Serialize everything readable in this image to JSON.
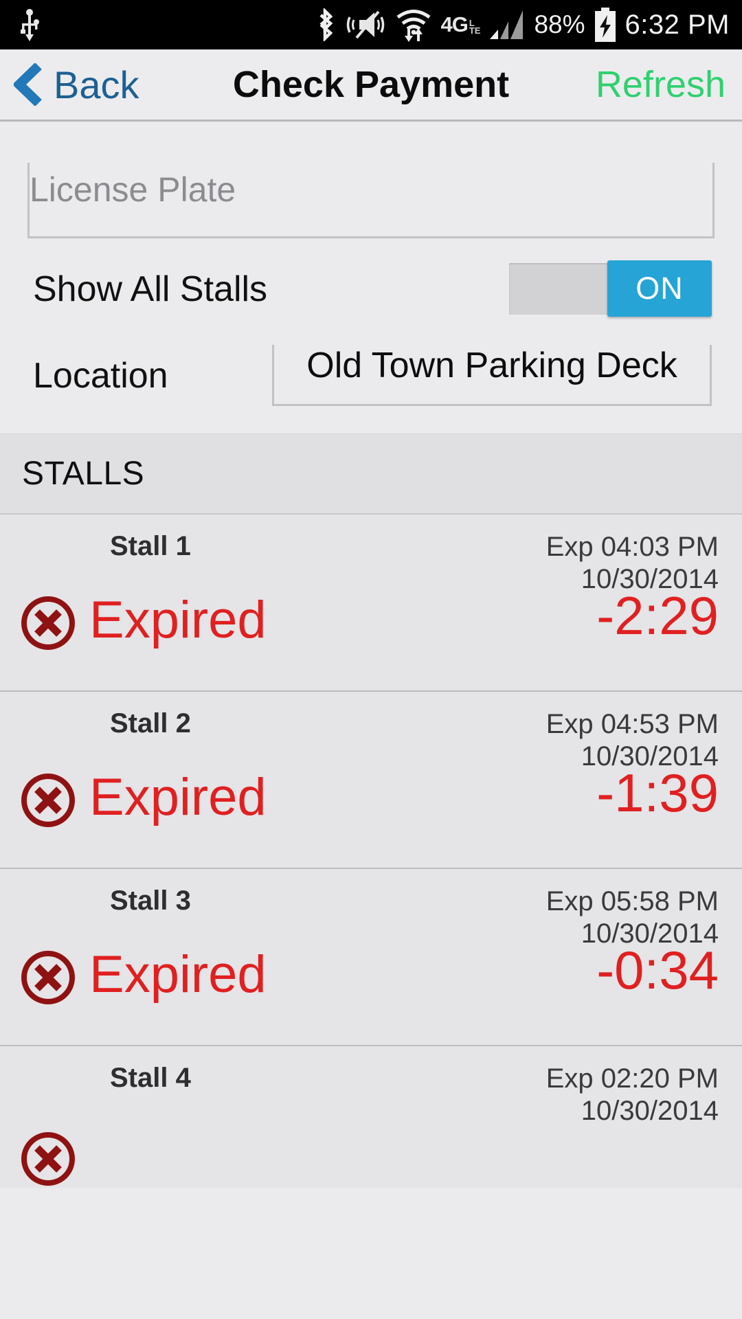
{
  "status_bar": {
    "icons": [
      "usb-icon",
      "bluetooth-icon",
      "vibrate-mute-icon",
      "wifi-icon"
    ],
    "network": "4G",
    "network_sub_top": "L",
    "network_sub_bottom": "TE",
    "battery_percent": "88%",
    "time": "6:32 PM"
  },
  "action_bar": {
    "back_label": "Back",
    "title": "Check Payment",
    "refresh_label": "Refresh"
  },
  "form": {
    "license_plate_placeholder": "License Plate",
    "license_plate_value": "",
    "show_all_stalls_label": "Show All Stalls",
    "show_all_stalls_state": "ON",
    "location_label": "Location",
    "location_value": "Old Town Parking Deck"
  },
  "section": {
    "stalls_header": "STALLS"
  },
  "stalls": [
    {
      "name": "Stall 1",
      "exp_time": "Exp 04:03 PM",
      "exp_date": "10/30/2014",
      "status": "Expired",
      "remaining": "-2:29",
      "icon": "circle-x-icon"
    },
    {
      "name": "Stall 2",
      "exp_time": "Exp 04:53 PM",
      "exp_date": "10/30/2014",
      "status": "Expired",
      "remaining": "-1:39",
      "icon": "circle-x-icon"
    },
    {
      "name": "Stall 3",
      "exp_time": "Exp 05:58 PM",
      "exp_date": "10/30/2014",
      "status": "Expired",
      "remaining": "-0:34",
      "icon": "circle-x-icon"
    },
    {
      "name": "Stall 4",
      "exp_time": "Exp 02:20 PM",
      "exp_date": "10/30/2014",
      "status": "",
      "remaining": "",
      "icon": "circle-x-icon"
    }
  ],
  "colors": {
    "expired_red": "#e02020",
    "icon_dark_red": "#8f1212",
    "accent_blue": "#26a4d6",
    "back_blue": "#1d6093",
    "refresh_green": "#2fd06f",
    "screen_bg": "#ebeaec",
    "row_bg": "#e5e4e7"
  }
}
